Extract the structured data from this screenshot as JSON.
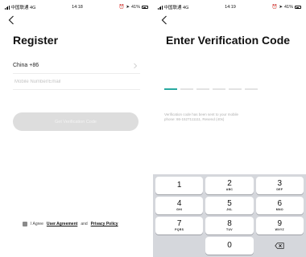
{
  "left_screen": {
    "status_bar": {
      "carrier": "中国联通 4G",
      "time": "14:18",
      "battery": "41%"
    },
    "title": "Register",
    "country_code": "China +86",
    "contact_placeholder": "Mobile Number/Email",
    "get_code_label": "Get Verification Code",
    "agreement": {
      "prefix": "I Agree",
      "user_agreement": "User Agreement",
      "and": "and",
      "privacy_policy": "Privacy Policy"
    }
  },
  "right_screen": {
    "status_bar": {
      "carrier": "中国联通 4G",
      "time": "14:19",
      "battery": "41%"
    },
    "title": "Enter Verification Code",
    "code_slot_count": 6,
    "hint_line1": "Verification code has been sent to your mobile",
    "hint_line2": "phone: 86-1527111111, Resend (40s)",
    "keypad": {
      "rows": [
        [
          {
            "number": "1",
            "letters": ""
          },
          {
            "number": "2",
            "letters": "ABC"
          },
          {
            "number": "3",
            "letters": "DEF"
          }
        ],
        [
          {
            "number": "4",
            "letters": "GHI"
          },
          {
            "number": "5",
            "letters": "JKL"
          },
          {
            "number": "6",
            "letters": "MNO"
          }
        ],
        [
          {
            "number": "7",
            "letters": "PQRS"
          },
          {
            "number": "8",
            "letters": "TUV"
          },
          {
            "number": "9",
            "letters": "WXYZ"
          }
        ],
        [
          {
            "number": "",
            "letters": ""
          },
          {
            "number": "0",
            "letters": ""
          },
          {
            "number": "",
            "letters": ""
          }
        ]
      ]
    }
  }
}
